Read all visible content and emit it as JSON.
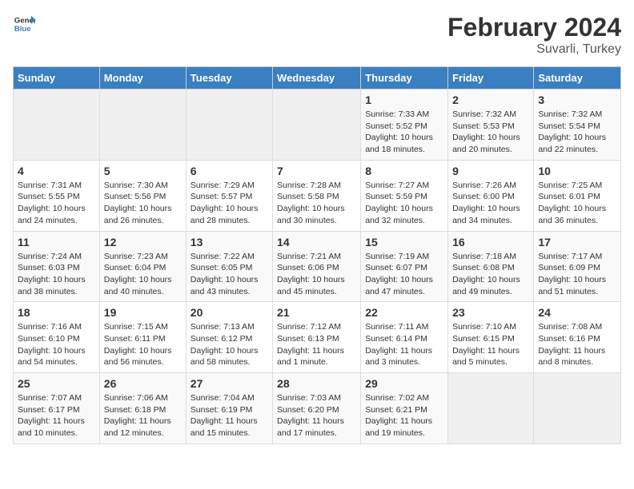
{
  "header": {
    "logo_line1": "General",
    "logo_line2": "Blue",
    "main_title": "February 2024",
    "subtitle": "Suvarli, Turkey"
  },
  "weekdays": [
    "Sunday",
    "Monday",
    "Tuesday",
    "Wednesday",
    "Thursday",
    "Friday",
    "Saturday"
  ],
  "weeks": [
    [
      {
        "day": "",
        "empty": true
      },
      {
        "day": "",
        "empty": true
      },
      {
        "day": "",
        "empty": true
      },
      {
        "day": "",
        "empty": true
      },
      {
        "day": "1",
        "sunrise": "7:33 AM",
        "sunset": "5:52 PM",
        "daylight": "10 hours and 18 minutes."
      },
      {
        "day": "2",
        "sunrise": "7:32 AM",
        "sunset": "5:53 PM",
        "daylight": "10 hours and 20 minutes."
      },
      {
        "day": "3",
        "sunrise": "7:32 AM",
        "sunset": "5:54 PM",
        "daylight": "10 hours and 22 minutes."
      }
    ],
    [
      {
        "day": "4",
        "sunrise": "7:31 AM",
        "sunset": "5:55 PM",
        "daylight": "10 hours and 24 minutes."
      },
      {
        "day": "5",
        "sunrise": "7:30 AM",
        "sunset": "5:56 PM",
        "daylight": "10 hours and 26 minutes."
      },
      {
        "day": "6",
        "sunrise": "7:29 AM",
        "sunset": "5:57 PM",
        "daylight": "10 hours and 28 minutes."
      },
      {
        "day": "7",
        "sunrise": "7:28 AM",
        "sunset": "5:58 PM",
        "daylight": "10 hours and 30 minutes."
      },
      {
        "day": "8",
        "sunrise": "7:27 AM",
        "sunset": "5:59 PM",
        "daylight": "10 hours and 32 minutes."
      },
      {
        "day": "9",
        "sunrise": "7:26 AM",
        "sunset": "6:00 PM",
        "daylight": "10 hours and 34 minutes."
      },
      {
        "day": "10",
        "sunrise": "7:25 AM",
        "sunset": "6:01 PM",
        "daylight": "10 hours and 36 minutes."
      }
    ],
    [
      {
        "day": "11",
        "sunrise": "7:24 AM",
        "sunset": "6:03 PM",
        "daylight": "10 hours and 38 minutes."
      },
      {
        "day": "12",
        "sunrise": "7:23 AM",
        "sunset": "6:04 PM",
        "daylight": "10 hours and 40 minutes."
      },
      {
        "day": "13",
        "sunrise": "7:22 AM",
        "sunset": "6:05 PM",
        "daylight": "10 hours and 43 minutes."
      },
      {
        "day": "14",
        "sunrise": "7:21 AM",
        "sunset": "6:06 PM",
        "daylight": "10 hours and 45 minutes."
      },
      {
        "day": "15",
        "sunrise": "7:19 AM",
        "sunset": "6:07 PM",
        "daylight": "10 hours and 47 minutes."
      },
      {
        "day": "16",
        "sunrise": "7:18 AM",
        "sunset": "6:08 PM",
        "daylight": "10 hours and 49 minutes."
      },
      {
        "day": "17",
        "sunrise": "7:17 AM",
        "sunset": "6:09 PM",
        "daylight": "10 hours and 51 minutes."
      }
    ],
    [
      {
        "day": "18",
        "sunrise": "7:16 AM",
        "sunset": "6:10 PM",
        "daylight": "10 hours and 54 minutes."
      },
      {
        "day": "19",
        "sunrise": "7:15 AM",
        "sunset": "6:11 PM",
        "daylight": "10 hours and 56 minutes."
      },
      {
        "day": "20",
        "sunrise": "7:13 AM",
        "sunset": "6:12 PM",
        "daylight": "10 hours and 58 minutes."
      },
      {
        "day": "21",
        "sunrise": "7:12 AM",
        "sunset": "6:13 PM",
        "daylight": "11 hours and 1 minute."
      },
      {
        "day": "22",
        "sunrise": "7:11 AM",
        "sunset": "6:14 PM",
        "daylight": "11 hours and 3 minutes."
      },
      {
        "day": "23",
        "sunrise": "7:10 AM",
        "sunset": "6:15 PM",
        "daylight": "11 hours and 5 minutes."
      },
      {
        "day": "24",
        "sunrise": "7:08 AM",
        "sunset": "6:16 PM",
        "daylight": "11 hours and 8 minutes."
      }
    ],
    [
      {
        "day": "25",
        "sunrise": "7:07 AM",
        "sunset": "6:17 PM",
        "daylight": "11 hours and 10 minutes."
      },
      {
        "day": "26",
        "sunrise": "7:06 AM",
        "sunset": "6:18 PM",
        "daylight": "11 hours and 12 minutes."
      },
      {
        "day": "27",
        "sunrise": "7:04 AM",
        "sunset": "6:19 PM",
        "daylight": "11 hours and 15 minutes."
      },
      {
        "day": "28",
        "sunrise": "7:03 AM",
        "sunset": "6:20 PM",
        "daylight": "11 hours and 17 minutes."
      },
      {
        "day": "29",
        "sunrise": "7:02 AM",
        "sunset": "6:21 PM",
        "daylight": "11 hours and 19 minutes."
      },
      {
        "day": "",
        "empty": true
      },
      {
        "day": "",
        "empty": true
      }
    ]
  ]
}
